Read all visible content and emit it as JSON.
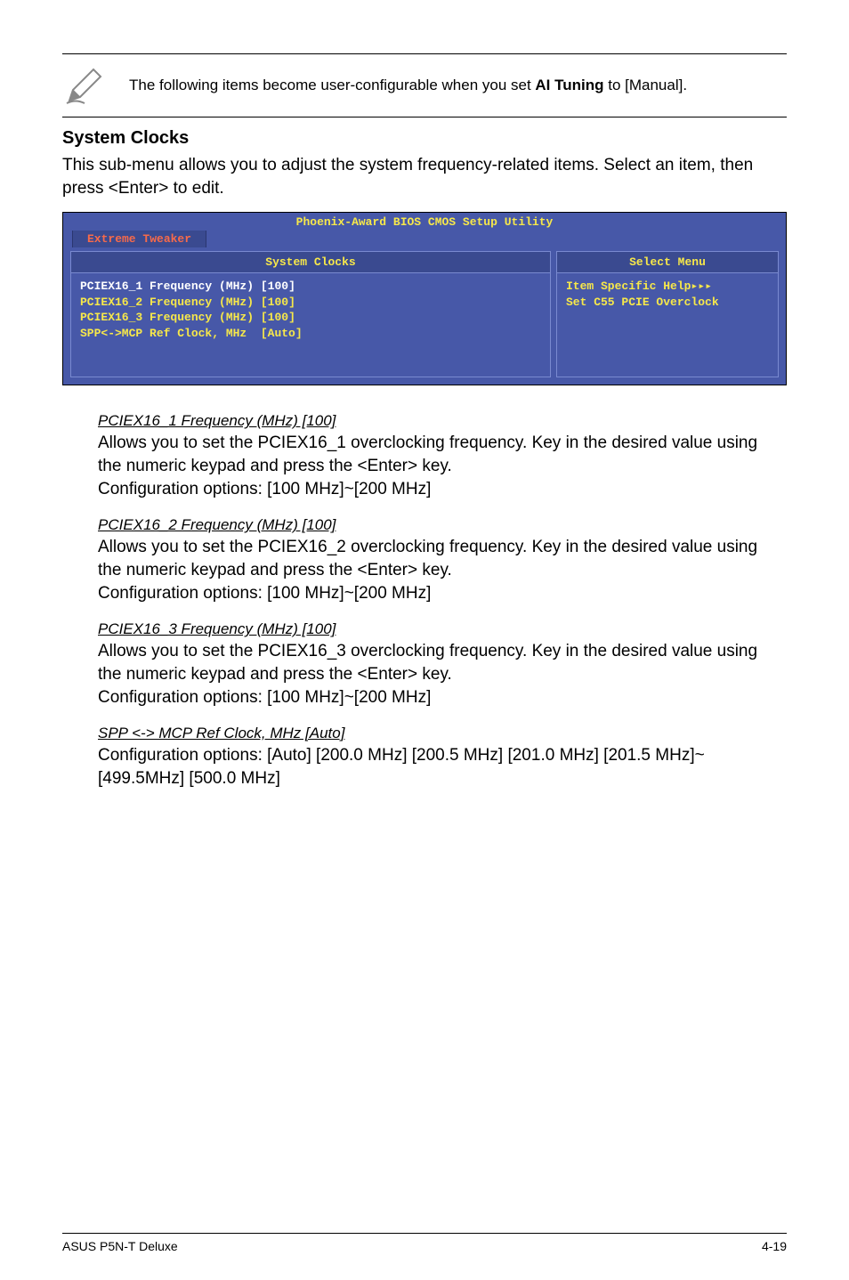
{
  "note": {
    "text_before": "The following items become user-configurable when you set ",
    "bold": "AI Tuning",
    "text_after": " to [Manual]."
  },
  "heading": "System Clocks",
  "description": "This sub-menu allows you to adjust the system frequency-related items. Select an item, then press <Enter> to edit.",
  "bios": {
    "title": "Phoenix-Award BIOS CMOS Setup Utility",
    "tab": "Extreme Tweaker",
    "left_header": "System Clocks",
    "right_header": "Select Menu",
    "rows": [
      {
        "label": "PCIEX16_1 Frequency (MHz)",
        "value": "[100]"
      },
      {
        "label": "PCIEX16_2 Frequency (MHz)",
        "value": "[100]"
      },
      {
        "label": "PCIEX16_3 Frequency (MHz)",
        "value": "[100]"
      },
      {
        "label": "SPP<->MCP Ref Clock, MHz",
        "value": "[Auto]"
      }
    ],
    "help_line1": "Item Specific Help▸▸▸",
    "help_line2": "Set C55 PCIE Overclock"
  },
  "items": [
    {
      "title": "PCIEX16_1 Frequency (MHz) [100]",
      "body": "Allows you to set the PCIEX16_1 overclocking frequency. Key in the desired value using the numeric keypad and press the <Enter> key.\nConfiguration options: [100 MHz]~[200 MHz]"
    },
    {
      "title": "PCIEX16_2 Frequency (MHz) [100]",
      "body": "Allows you to set the PCIEX16_2 overclocking frequency. Key in the desired value using the numeric keypad and press the <Enter> key.\nConfiguration options: [100 MHz]~[200 MHz]"
    },
    {
      "title": "PCIEX16_3 Frequency (MHz) [100]",
      "body": "Allows you to set the PCIEX16_3 overclocking frequency. Key in the desired value using the numeric keypad and press the <Enter> key.\nConfiguration options: [100 MHz]~[200 MHz]"
    },
    {
      "title": "SPP <-> MCP Ref Clock, MHz [Auto]",
      "body": "Configuration options: [Auto] [200.0 MHz] [200.5 MHz] [201.0 MHz] [201.5 MHz]~[499.5MHz] [500.0 MHz]"
    }
  ],
  "footer": {
    "left": "ASUS P5N-T Deluxe",
    "right": "4-19"
  }
}
